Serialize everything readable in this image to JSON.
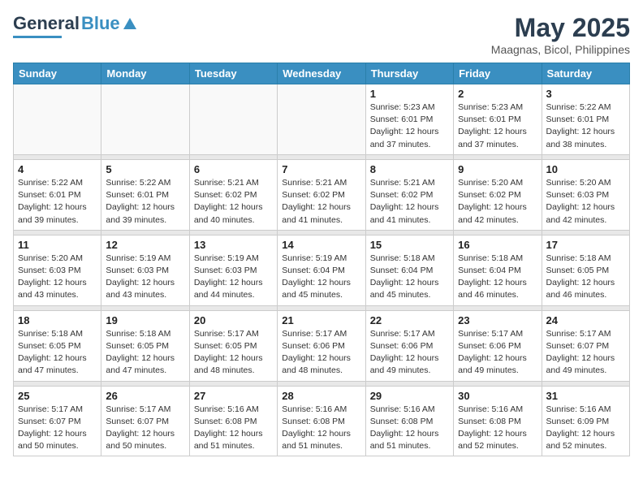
{
  "header": {
    "logo_general": "General",
    "logo_blue": "Blue",
    "title": "May 2025",
    "subtitle": "Maagnas, Bicol, Philippines"
  },
  "days_of_week": [
    "Sunday",
    "Monday",
    "Tuesday",
    "Wednesday",
    "Thursday",
    "Friday",
    "Saturday"
  ],
  "weeks": [
    [
      {
        "day": "",
        "info": ""
      },
      {
        "day": "",
        "info": ""
      },
      {
        "day": "",
        "info": ""
      },
      {
        "day": "",
        "info": ""
      },
      {
        "day": "1",
        "info": "Sunrise: 5:23 AM\nSunset: 6:01 PM\nDaylight: 12 hours\nand 37 minutes."
      },
      {
        "day": "2",
        "info": "Sunrise: 5:23 AM\nSunset: 6:01 PM\nDaylight: 12 hours\nand 37 minutes."
      },
      {
        "day": "3",
        "info": "Sunrise: 5:22 AM\nSunset: 6:01 PM\nDaylight: 12 hours\nand 38 minutes."
      }
    ],
    [
      {
        "day": "4",
        "info": "Sunrise: 5:22 AM\nSunset: 6:01 PM\nDaylight: 12 hours\nand 39 minutes."
      },
      {
        "day": "5",
        "info": "Sunrise: 5:22 AM\nSunset: 6:01 PM\nDaylight: 12 hours\nand 39 minutes."
      },
      {
        "day": "6",
        "info": "Sunrise: 5:21 AM\nSunset: 6:02 PM\nDaylight: 12 hours\nand 40 minutes."
      },
      {
        "day": "7",
        "info": "Sunrise: 5:21 AM\nSunset: 6:02 PM\nDaylight: 12 hours\nand 41 minutes."
      },
      {
        "day": "8",
        "info": "Sunrise: 5:21 AM\nSunset: 6:02 PM\nDaylight: 12 hours\nand 41 minutes."
      },
      {
        "day": "9",
        "info": "Sunrise: 5:20 AM\nSunset: 6:02 PM\nDaylight: 12 hours\nand 42 minutes."
      },
      {
        "day": "10",
        "info": "Sunrise: 5:20 AM\nSunset: 6:03 PM\nDaylight: 12 hours\nand 42 minutes."
      }
    ],
    [
      {
        "day": "11",
        "info": "Sunrise: 5:20 AM\nSunset: 6:03 PM\nDaylight: 12 hours\nand 43 minutes."
      },
      {
        "day": "12",
        "info": "Sunrise: 5:19 AM\nSunset: 6:03 PM\nDaylight: 12 hours\nand 43 minutes."
      },
      {
        "day": "13",
        "info": "Sunrise: 5:19 AM\nSunset: 6:03 PM\nDaylight: 12 hours\nand 44 minutes."
      },
      {
        "day": "14",
        "info": "Sunrise: 5:19 AM\nSunset: 6:04 PM\nDaylight: 12 hours\nand 45 minutes."
      },
      {
        "day": "15",
        "info": "Sunrise: 5:18 AM\nSunset: 6:04 PM\nDaylight: 12 hours\nand 45 minutes."
      },
      {
        "day": "16",
        "info": "Sunrise: 5:18 AM\nSunset: 6:04 PM\nDaylight: 12 hours\nand 46 minutes."
      },
      {
        "day": "17",
        "info": "Sunrise: 5:18 AM\nSunset: 6:05 PM\nDaylight: 12 hours\nand 46 minutes."
      }
    ],
    [
      {
        "day": "18",
        "info": "Sunrise: 5:18 AM\nSunset: 6:05 PM\nDaylight: 12 hours\nand 47 minutes."
      },
      {
        "day": "19",
        "info": "Sunrise: 5:18 AM\nSunset: 6:05 PM\nDaylight: 12 hours\nand 47 minutes."
      },
      {
        "day": "20",
        "info": "Sunrise: 5:17 AM\nSunset: 6:05 PM\nDaylight: 12 hours\nand 48 minutes."
      },
      {
        "day": "21",
        "info": "Sunrise: 5:17 AM\nSunset: 6:06 PM\nDaylight: 12 hours\nand 48 minutes."
      },
      {
        "day": "22",
        "info": "Sunrise: 5:17 AM\nSunset: 6:06 PM\nDaylight: 12 hours\nand 49 minutes."
      },
      {
        "day": "23",
        "info": "Sunrise: 5:17 AM\nSunset: 6:06 PM\nDaylight: 12 hours\nand 49 minutes."
      },
      {
        "day": "24",
        "info": "Sunrise: 5:17 AM\nSunset: 6:07 PM\nDaylight: 12 hours\nand 49 minutes."
      }
    ],
    [
      {
        "day": "25",
        "info": "Sunrise: 5:17 AM\nSunset: 6:07 PM\nDaylight: 12 hours\nand 50 minutes."
      },
      {
        "day": "26",
        "info": "Sunrise: 5:17 AM\nSunset: 6:07 PM\nDaylight: 12 hours\nand 50 minutes."
      },
      {
        "day": "27",
        "info": "Sunrise: 5:16 AM\nSunset: 6:08 PM\nDaylight: 12 hours\nand 51 minutes."
      },
      {
        "day": "28",
        "info": "Sunrise: 5:16 AM\nSunset: 6:08 PM\nDaylight: 12 hours\nand 51 minutes."
      },
      {
        "day": "29",
        "info": "Sunrise: 5:16 AM\nSunset: 6:08 PM\nDaylight: 12 hours\nand 51 minutes."
      },
      {
        "day": "30",
        "info": "Sunrise: 5:16 AM\nSunset: 6:08 PM\nDaylight: 12 hours\nand 52 minutes."
      },
      {
        "day": "31",
        "info": "Sunrise: 5:16 AM\nSunset: 6:09 PM\nDaylight: 12 hours\nand 52 minutes."
      }
    ]
  ]
}
